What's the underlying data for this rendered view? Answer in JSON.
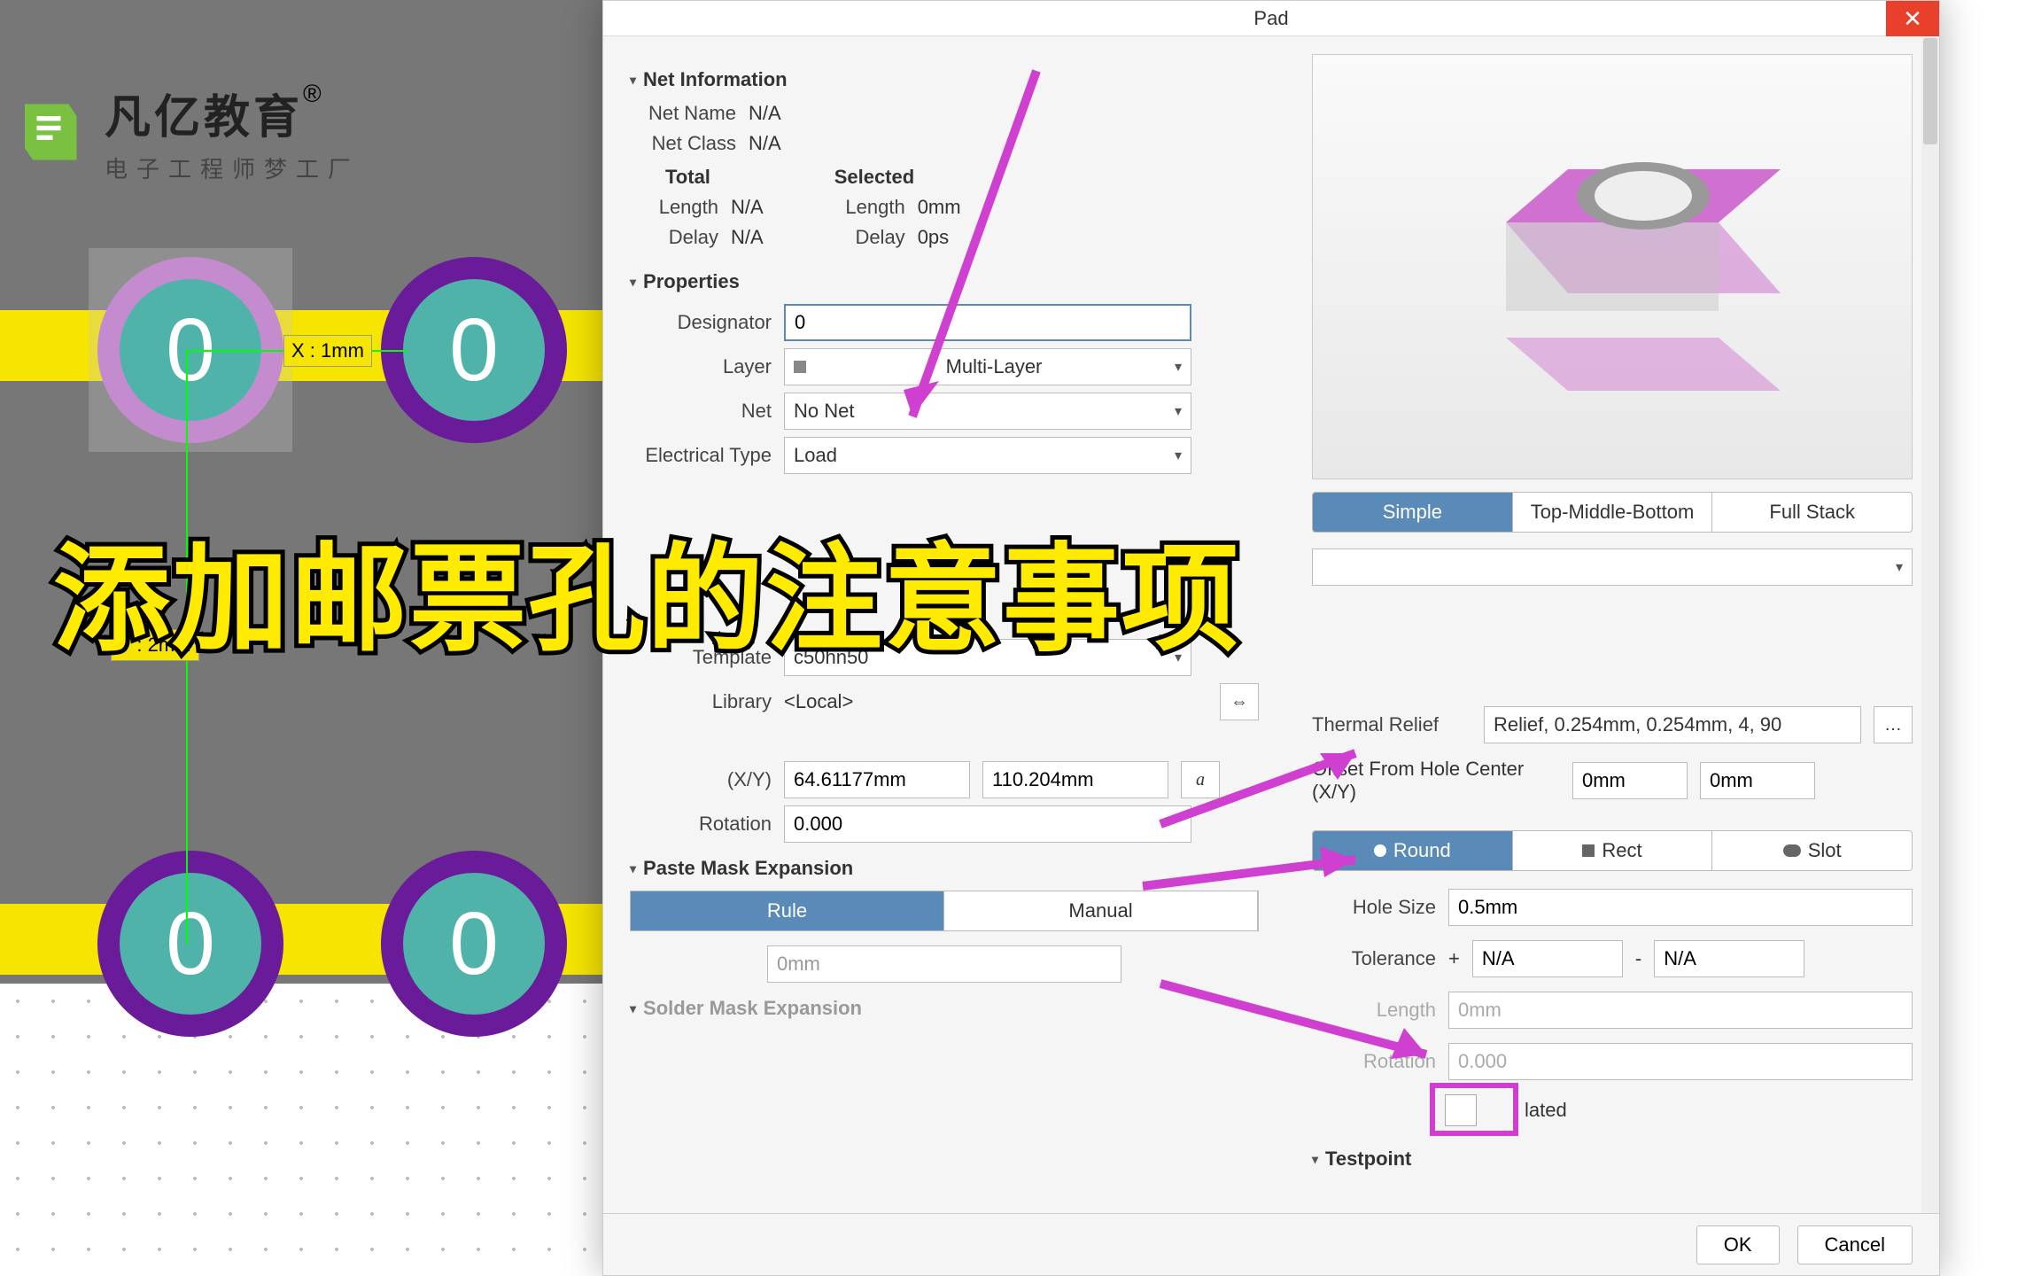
{
  "logo": {
    "main": "凡亿教育",
    "sub": "电子工程师梦工厂",
    "reg": "®"
  },
  "canvas": {
    "x_label": "X : 1mm",
    "y_label": "Y : 2mm",
    "pad_zero": "0"
  },
  "overlay_title": "添加邮票孔的注意事项",
  "dialog": {
    "title": "Pad",
    "sections": {
      "net_info": {
        "header": "Net Information",
        "net_name_lbl": "Net Name",
        "net_name_val": "N/A",
        "net_class_lbl": "Net Class",
        "net_class_val": "N/A",
        "total_lbl": "Total",
        "selected_lbl": "Selected",
        "length_lbl": "Length",
        "length_val": "N/A",
        "sel_length_lbl": "Length",
        "sel_length_val": "0mm",
        "delay_lbl": "Delay",
        "delay_val": "N/A",
        "sel_delay_lbl": "Delay",
        "sel_delay_val": "0ps"
      },
      "properties": {
        "header": "Properties",
        "designator_lbl": "Designator",
        "designator_val": "0",
        "layer_lbl": "Layer",
        "layer_val": "Multi-Layer",
        "net_lbl": "Net",
        "net_val": "No Net",
        "etype_lbl": "Electrical Type",
        "etype_val": "Load",
        "template_lbl": "Template",
        "template_val": "c50hn50",
        "library_lbl": "Library",
        "library_val": "<Local>",
        "xy_lbl": "(X/Y)",
        "x_val": "64.61177mm",
        "y_val": "110.204mm",
        "rotation_lbl": "Rotation",
        "rotation_val": "0.000",
        "lock_icon": "a"
      },
      "paste_mask": {
        "header": "Paste Mask Expansion",
        "rule_tab": "Rule",
        "manual_tab": "Manual",
        "value": "0mm"
      },
      "solder_mask": {
        "header": "Solder Mask Expansion"
      },
      "right_tabs": {
        "simple": "Simple",
        "tmb": "Top-Middle-Bottom",
        "full": "Full Stack"
      },
      "thermal": {
        "label": "Thermal Relief",
        "value": "Relief, 0.254mm, 0.254mm, 4, 90"
      },
      "offset": {
        "label": "Offset From Hole Center (X/Y)",
        "x": "0mm",
        "y": "0mm"
      },
      "hole_shape": {
        "round": "Round",
        "rect": "Rect",
        "slot": "Slot"
      },
      "hole": {
        "size_lbl": "Hole Size",
        "size_val": "0.5mm",
        "tol_lbl": "Tolerance",
        "tol_plus": "+",
        "tol_plus_val": "N/A",
        "tol_minus": "-",
        "tol_minus_val": "N/A",
        "length_lbl": "Length",
        "length_val": "0mm",
        "rotation_lbl": "Rotation",
        "rotation_val": "0.000",
        "plated_lbl": "lated"
      },
      "testpoint": {
        "header": "Testpoint"
      }
    },
    "ok": "OK",
    "cancel": "Cancel",
    "link_icon": "⇔"
  }
}
